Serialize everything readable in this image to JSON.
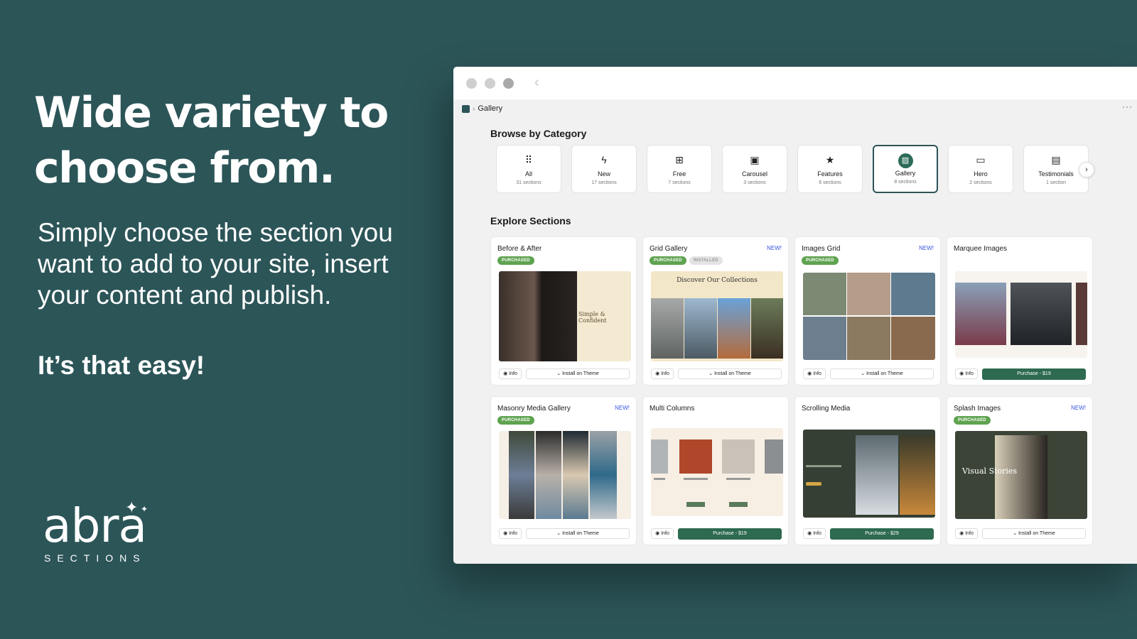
{
  "hero": {
    "headline": "Wide variety to choose from.",
    "subtext": "Simply choose the section you want to add to your site, insert your content and publish.",
    "tagline": "It’s that easy!"
  },
  "logo": {
    "word": "abra",
    "sub": "SECTIONS"
  },
  "window": {
    "breadcrumb": "Gallery",
    "browse_title": "Browse by Category",
    "explore_title": "Explore Sections"
  },
  "categories": [
    {
      "label": "All",
      "count": "31 sections",
      "icon": "grid-icon"
    },
    {
      "label": "New",
      "count": "17 sections",
      "icon": "bolt-icon"
    },
    {
      "label": "Free",
      "count": "7 sections",
      "icon": "gift-icon"
    },
    {
      "label": "Carousel",
      "count": "3 sections",
      "icon": "carousel-icon"
    },
    {
      "label": "Features",
      "count": "6 sections",
      "icon": "star-icon"
    },
    {
      "label": "Gallery",
      "count": "8 sections",
      "icon": "image-icon",
      "active": true
    },
    {
      "label": "Hero",
      "count": "2 sections",
      "icon": "monitor-icon"
    },
    {
      "label": "Testimonials",
      "count": "1 section",
      "icon": "chat-icon"
    }
  ],
  "cards": [
    {
      "title": "Before & After",
      "new": "",
      "badges": [
        "PURCHASED"
      ],
      "action": "Install on Theme",
      "thumb_text": "Simple & Confident"
    },
    {
      "title": "Grid Gallery",
      "new": "NEW!",
      "badges": [
        "PURCHASED",
        "INSTALLED"
      ],
      "action": "Install on Theme",
      "thumb_text": "Discover Our Collections"
    },
    {
      "title": "Images Grid",
      "new": "NEW!",
      "badges": [
        "PURCHASED"
      ],
      "action": "Install on Theme"
    },
    {
      "title": "Marquee Images",
      "new": "",
      "badges": [],
      "action": "Purchase - $19"
    },
    {
      "title": "Masonry Media Gallery",
      "new": "NEW!",
      "badges": [
        "PURCHASED"
      ],
      "action": "Install on Theme"
    },
    {
      "title": "Multi Columns",
      "new": "",
      "badges": [],
      "action": "Purchase - $19"
    },
    {
      "title": "Scrolling Media",
      "new": "",
      "badges": [],
      "action": "Purchase - $29"
    },
    {
      "title": "Splash Images",
      "new": "NEW!",
      "badges": [
        "PURCHASED"
      ],
      "action": "Install on Theme",
      "thumb_text": "Visual Stories"
    }
  ],
  "info_label": "Info",
  "colors": {
    "background": "#2c5558",
    "accent": "#2d6a4f",
    "badge": "#5fa350",
    "new": "#3b55e6"
  }
}
